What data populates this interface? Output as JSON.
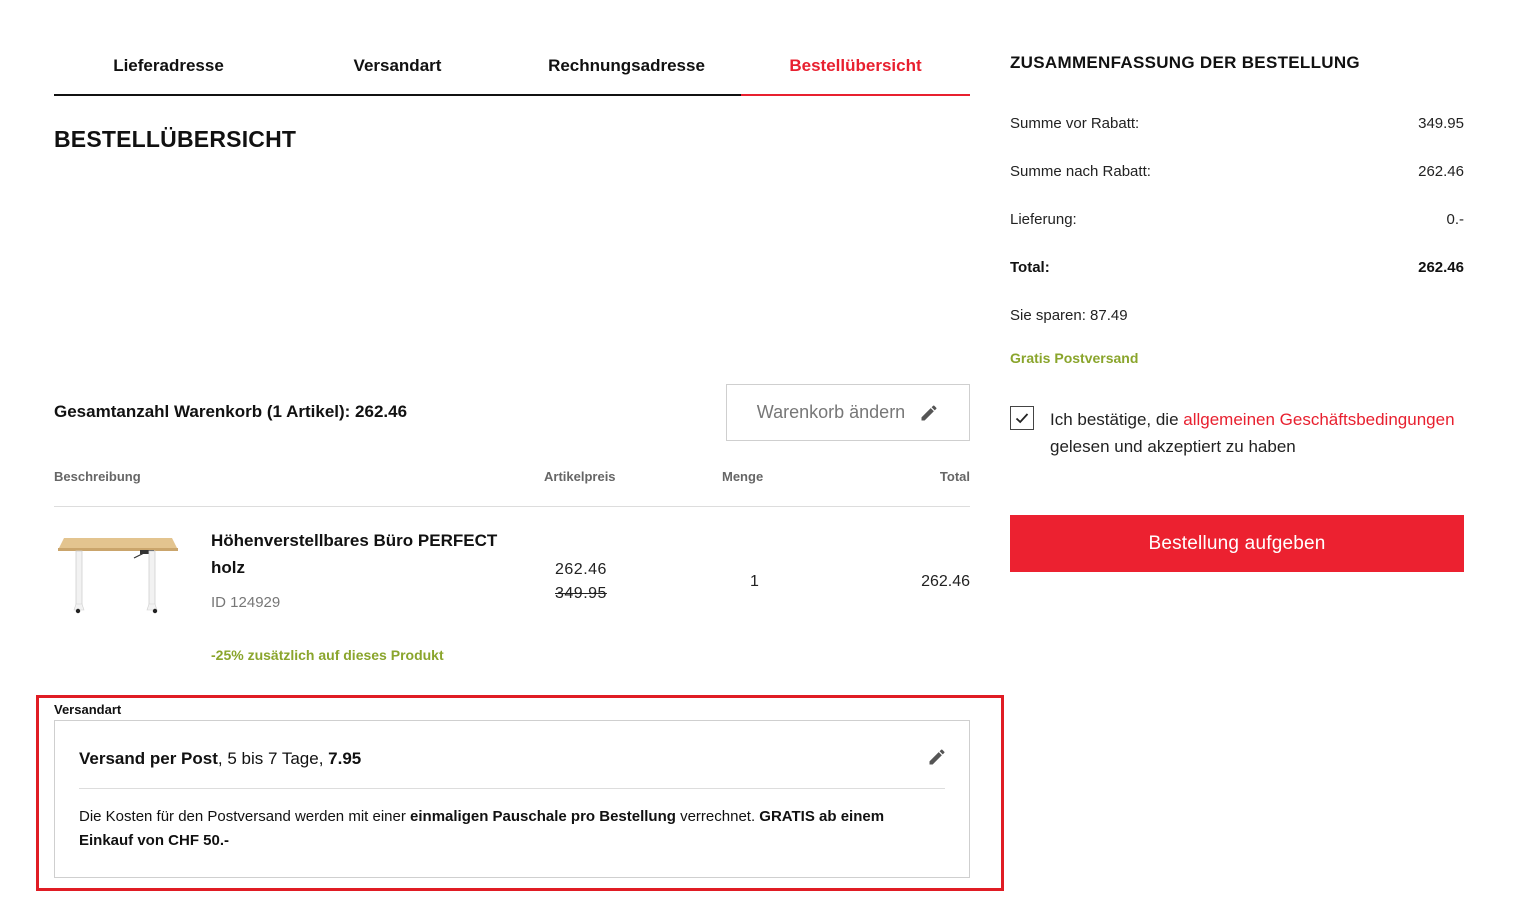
{
  "tabs": [
    {
      "label": "Lieferadresse"
    },
    {
      "label": "Versandart"
    },
    {
      "label": "Rechnungsadresse"
    },
    {
      "label": "Bestellübersicht"
    }
  ],
  "colors": {
    "accent": "#e8202f",
    "green": "#8aa52c",
    "button": "#ec2130",
    "highlight": "#e01c24"
  },
  "page": {
    "title": "BESTELLÜBERSICHT"
  },
  "cart": {
    "total_label": "Gesamtanzahl Warenkorb (1 Artikel): 262.46",
    "edit_button": "Warenkorb ändern",
    "edit_icon": "pencil-icon"
  },
  "table": {
    "headers": {
      "description": "Beschreibung",
      "price": "Artikelpreis",
      "quantity": "Menge",
      "total": "Total"
    }
  },
  "product": {
    "name": "Höhenverstellbares Büro PERFECT holz",
    "id": "ID 124929",
    "discount": "-25% zusätzlich auf dieses Produkt",
    "price": "262.46",
    "old_price": "349.95",
    "quantity": "1",
    "total": "262.46"
  },
  "shipping": {
    "section_label": "Versandart",
    "method_name": "Versand per Post",
    "method_details": ", 5 bis 7 Tage, ",
    "method_price": "7.95",
    "desc_part1": "Die Kosten für den Postversand werden mit einer ",
    "desc_bold1": "einmaligen Pauschale pro Bestellung",
    "desc_part2": " verrechnet. ",
    "desc_bold2": "GRATIS ab einem Einkauf von CHF  50.-"
  },
  "summary": {
    "title": "ZUSAMMENFASSUNG DER BESTELLUNG",
    "before_discount_label": "Summe vor Rabatt:",
    "before_discount_value": "349.95",
    "after_discount_label": "Summe nach Rabatt:",
    "after_discount_value": "262.46",
    "delivery_label": "Lieferung:",
    "delivery_value": "0.-",
    "total_label": "Total:",
    "total_value": "262.46",
    "savings": "Sie sparen: 87.49",
    "free_shipping": "Gratis Postversand"
  },
  "terms": {
    "text_before": "Ich bestätige, die ",
    "link": "allgemeinen Geschäftsbedingungen",
    "text_after": " gelesen und akzeptiert zu haben",
    "checked": true
  },
  "order_button": "Bestellung aufgeben"
}
